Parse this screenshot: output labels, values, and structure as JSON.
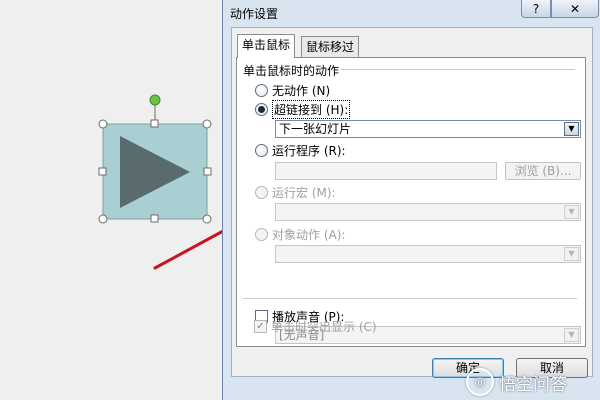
{
  "dialog": {
    "title": "动作设置",
    "help_label": "?",
    "close_label": "✕",
    "tabs": [
      {
        "label": "单击鼠标",
        "active": true
      },
      {
        "label": "鼠标移过",
        "active": false
      }
    ],
    "group_title": "单击鼠标时的动作",
    "options": {
      "none": "无动作 (N)",
      "hyperlink": "超链接到 (H):",
      "run_program": "运行程序 (R):",
      "run_macro": "运行宏 (M):",
      "object_action": "对象动作 (A):"
    },
    "selected_option": "hyperlink",
    "hyperlink_value": "下一张幻灯片",
    "program_value": "",
    "browse_label": "浏览 (B)...",
    "macro_value": "",
    "object_action_value": "",
    "play_sound_label": "播放声音 (P):",
    "play_sound_checked": false,
    "sound_value": "[无声音]",
    "highlight_label": "单击时突出显示 (C)",
    "highlight_checked": true,
    "ok_label": "确定",
    "cancel_label": "取消"
  },
  "slide": {
    "shape_icon": "play-triangle-icon",
    "shape_fill": "#a9cfd2",
    "triangle_fill": "#5a6b6f",
    "rotate_handle_color": "#6dc24b",
    "annotation_color": "#c8141e"
  },
  "watermark": {
    "text": "悟空问答",
    "logo_icon": "wukong-logo-icon"
  },
  "colors": {
    "dialog_frame": "#d9e4f1",
    "default_button_border": "#3c7fb1"
  }
}
